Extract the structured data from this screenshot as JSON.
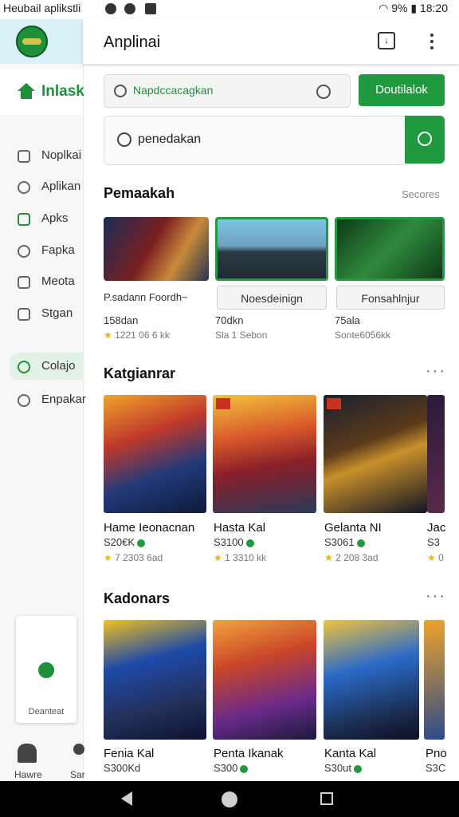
{
  "status_bar": {
    "left_text": "Heubail aplikstli",
    "signal": "9%",
    "time": "18:20"
  },
  "sidebar": {
    "home_label": "Inlask",
    "items": [
      {
        "label": "Noplkai",
        "icon": "store-icon"
      },
      {
        "label": "Aplikan",
        "icon": "apps-icon"
      },
      {
        "label": "Apks",
        "icon": "chart-icon"
      },
      {
        "label": "Fapka",
        "icon": "gear-icon"
      },
      {
        "label": "Meota",
        "icon": "list-icon"
      },
      {
        "label": "Stgan",
        "icon": "monitor-icon"
      },
      {
        "label": "Colajo",
        "icon": "search-icon"
      },
      {
        "label": "Enpakar",
        "icon": "settings-icon"
      }
    ],
    "card_label": "Deanteat",
    "bottom_home_label": "Hawre",
    "bottom_person_label": "Sar"
  },
  "header": {
    "title": "Anplinai"
  },
  "search": {
    "small_value": "Napdccacagkan",
    "button_label": "Doutilalok",
    "big_value": "penedakan"
  },
  "section1": {
    "title": "Pemaakah",
    "link": "Secores",
    "items": [
      {
        "tab": "P.sadann Foordh~",
        "meta1": "158dan",
        "meta2": "1221 06 6 kk"
      },
      {
        "tab": "Noesdeinign",
        "meta1": "70dkn",
        "meta2": "Sla 1 Sebon"
      },
      {
        "tab": "Fonsahlnjur",
        "meta1": "75ala",
        "meta2": "Sonte6056kk"
      }
    ]
  },
  "section2": {
    "title": "Katgianrar",
    "games": [
      {
        "title": "Hame Ieonacnan",
        "price": "S20€K",
        "rating": "7 2303 6ad"
      },
      {
        "title": "Hasta Kal",
        "price": "S3100",
        "rating": "1 3310 kk"
      },
      {
        "title": "Gelanta NI",
        "price": "S3061",
        "rating": "2 208 3ad"
      },
      {
        "title": "Jac",
        "price": "S3",
        "rating": "0"
      }
    ]
  },
  "section3": {
    "title": "Kadonars",
    "games": [
      {
        "title": "Fenia Kal",
        "price": "S300Kd"
      },
      {
        "title": "Penta Ikanak",
        "price": "S300"
      },
      {
        "title": "Kanta Kal",
        "price": "S30ut"
      },
      {
        "title": "Pno",
        "price": "S3C"
      }
    ]
  },
  "colors": {
    "accent": "#1f9a3e",
    "sidebar_bg": "#f6f7f6"
  }
}
